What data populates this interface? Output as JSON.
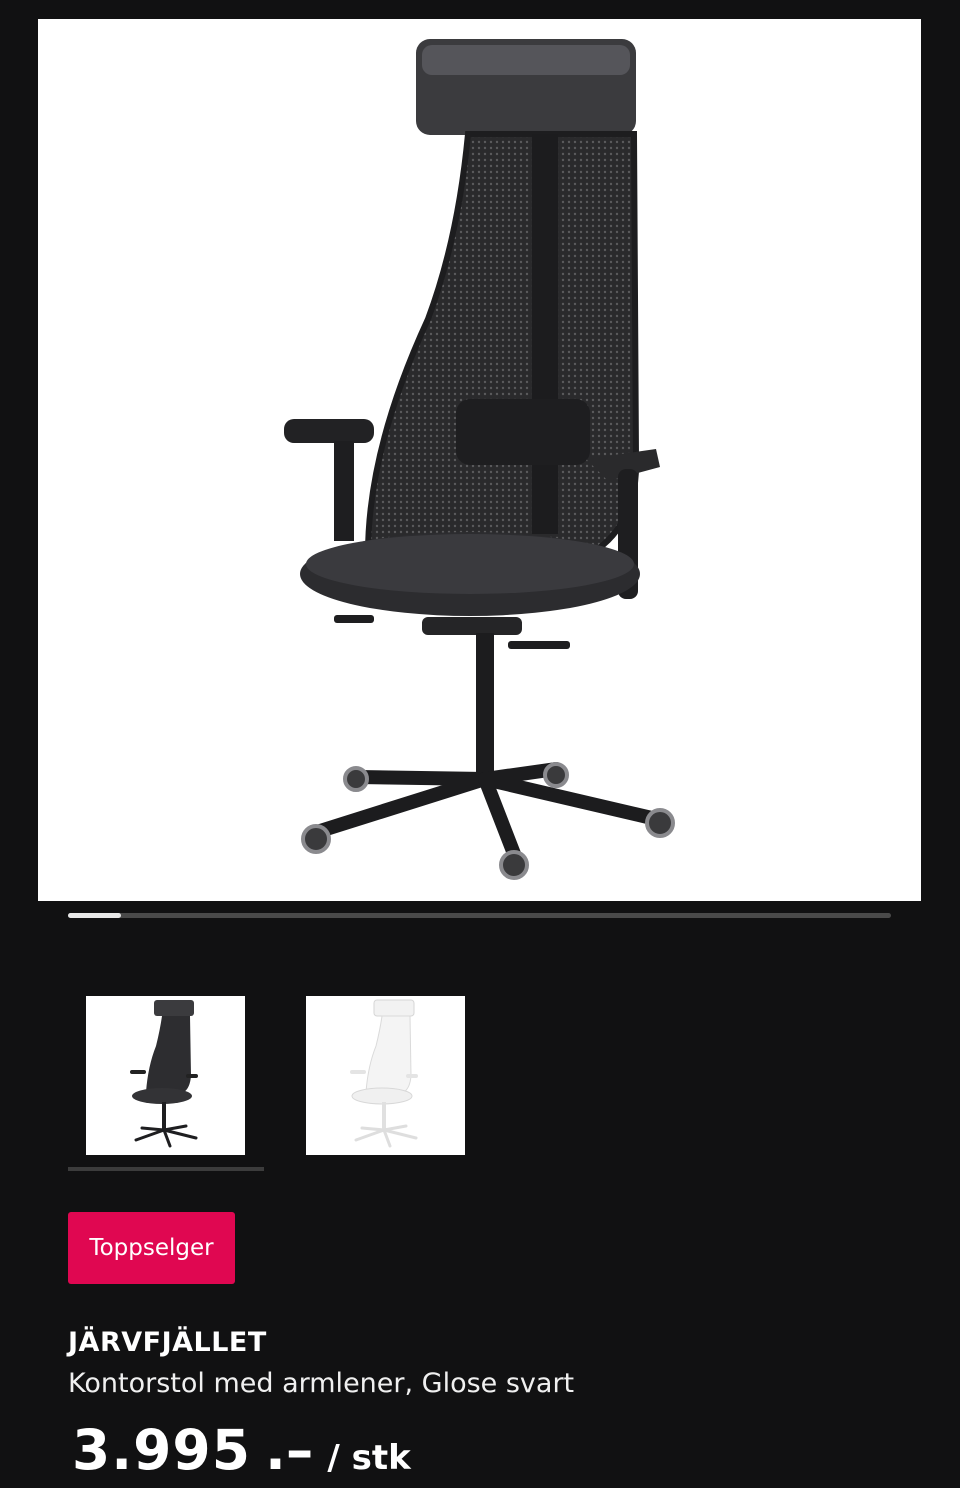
{
  "gallery": {
    "main_image_icon": "office-chair-black",
    "progress_fraction": 0.065,
    "thumbnails": [
      {
        "icon": "office-chair-black"
      },
      {
        "icon": "office-chair-white"
      }
    ]
  },
  "badge": {
    "label": "Toppselger",
    "color": "#e00751"
  },
  "product": {
    "name": "JÄRVFJÄLLET",
    "description": "Kontorstol med armlener, Glose svart"
  },
  "price": {
    "amount": "3.995",
    "suffix": ".–",
    "unit": "/ stk"
  }
}
